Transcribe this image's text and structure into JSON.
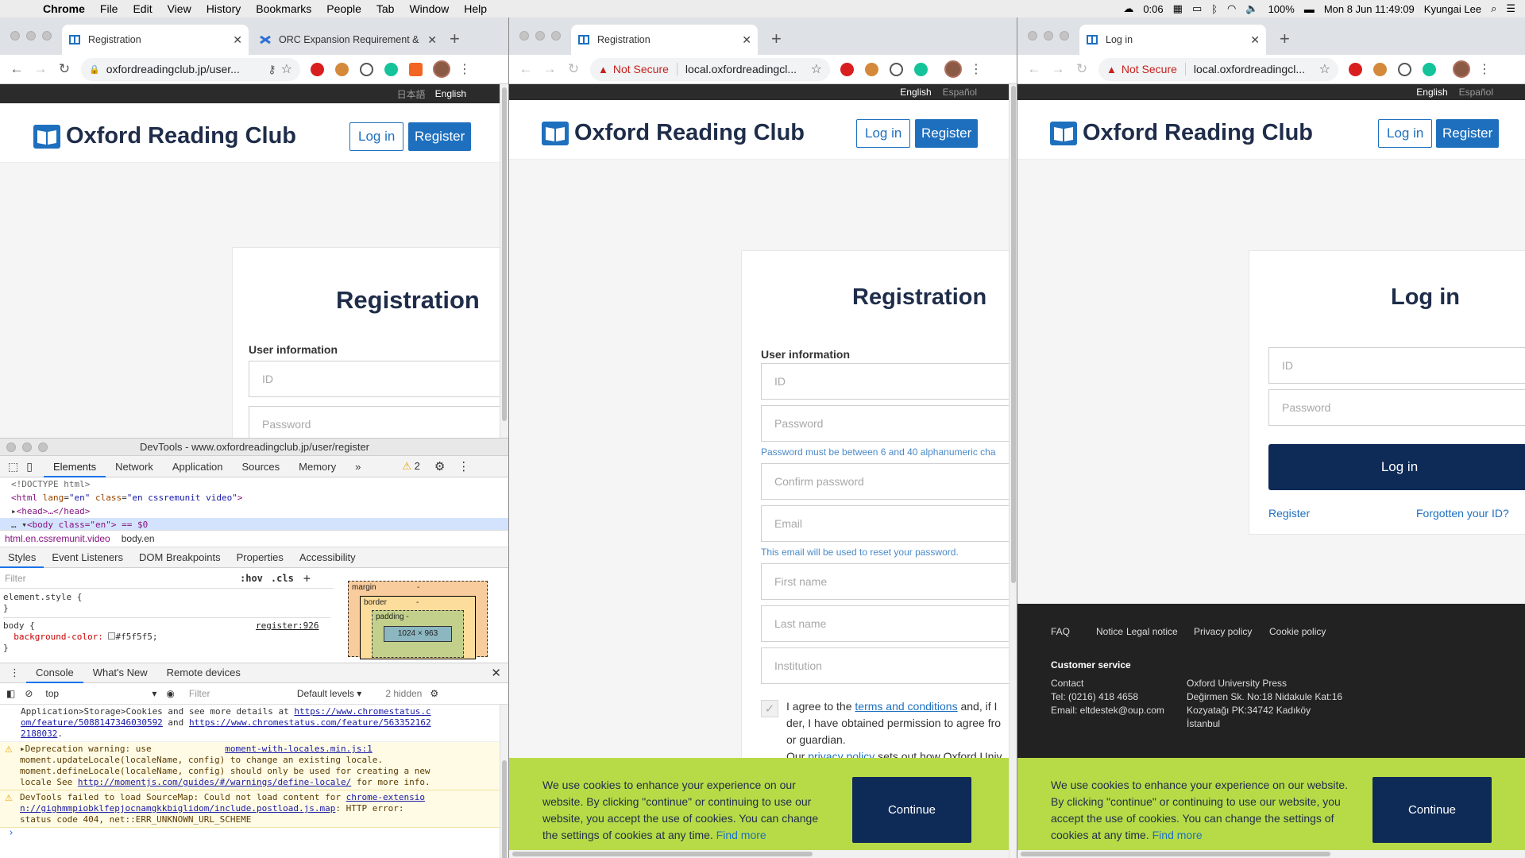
{
  "menubar": {
    "app": "Chrome",
    "items": [
      "File",
      "Edit",
      "View",
      "History",
      "Bookmarks",
      "People",
      "Tab",
      "Window",
      "Help"
    ],
    "clock_small": "0:06",
    "battery": "100%",
    "datetime": "Mon 8 Jun  11:49:09",
    "user": "Kyungai Lee"
  },
  "win1": {
    "tabs": [
      {
        "title": "Registration"
      },
      {
        "title": "ORC Expansion Requirement &"
      }
    ],
    "url": "oxfordreadingclub.jp/user...",
    "langs": [
      "日本語",
      "English"
    ],
    "site": {
      "name": "Oxford Reading Club",
      "login": "Log in",
      "register": "Register"
    },
    "form": {
      "title": "Registration",
      "section": "User information",
      "id_placeholder": "ID",
      "password_placeholder": "Password"
    }
  },
  "devtools": {
    "title": "DevTools - www.oxfordreadingclub.jp/user/register",
    "tabs": [
      "Elements",
      "Network",
      "Application",
      "Sources",
      "Memory",
      "»"
    ],
    "warn_count": "2",
    "dom": {
      "doctype": "<!DOCTYPE html>",
      "html_open": "<html",
      "html_lang_attr": "lang",
      "html_lang_val": "\"en\"",
      "html_class_attr": "class",
      "html_class_val": "\"en cssremunit video\"",
      "head": "<head>…</head>",
      "body": "<body class=\"en\"> == $0"
    },
    "crumbs": [
      "html.en.cssremunit.video",
      "body.en"
    ],
    "subtabs": [
      "Styles",
      "Event Listeners",
      "DOM Breakpoints",
      "Properties",
      "Accessibility"
    ],
    "styles": {
      "filter_placeholder": "Filter",
      "hov": ":hov",
      "cls": ".cls",
      "element_style": "element.style {",
      "close": "}",
      "body_selector": "body {",
      "source": "register:926",
      "prop": "background-color:",
      "value": "#f5f5f5;"
    },
    "boxmodel": {
      "margin": "margin",
      "border": "border",
      "padding": "padding -",
      "content": "1024 × 963",
      "dash": "-"
    },
    "drawer_tabs": [
      "Console",
      "What's New",
      "Remote devices"
    ],
    "console_bar": {
      "context": "top",
      "filter_placeholder": "Filter",
      "levels": "Default levels",
      "hidden": "2 hidden"
    },
    "messages": [
      {
        "text": "Application>Storage>Cookies and see more details at ",
        "link1": "https://www.chromestatus.c",
        "line2_link": "om/feature/5088147346030592",
        "mid": " and ",
        "link2": "https://www.chromestatus.com/feature/563352162",
        "line3_link": "2188032",
        "end": "."
      },
      {
        "line1": "▸Deprecation warning: use ",
        "src": "moment-with-locales.min.js:1",
        "line2": "moment.updateLocale(localeName, config) to change an existing locale.",
        "line3": "moment.defineLocale(localeName, config) should only be used for creating a new",
        "line4a": "locale See ",
        "line4link": "http://momentjs.com/guides/#/warnings/define-locale/",
        "line4b": " for more info."
      },
      {
        "line1": "DevTools failed to load SourceMap: Could not load content for ",
        "link1": "chrome-extensio",
        "link2": "n://gighmmpiobklfepjocnamgkkbiglidom/include.postload.js.map",
        "line2b": ": HTTP error:",
        "line3": "status code 404, net::ERR_UNKNOWN_URL_SCHEME"
      }
    ],
    "prompt": "›"
  },
  "win2": {
    "tab": "Registration",
    "not_secure": "Not Secure",
    "url": "local.oxfordreadingcl...",
    "langs": [
      "English",
      "Español"
    ],
    "site": {
      "name": "Oxford Reading Club",
      "login": "Log in",
      "register": "Register"
    },
    "form": {
      "title": "Registration",
      "section": "User information",
      "id": "ID",
      "password": "Password",
      "password_hint": "Password must be between 6 and 40 alphanumeric cha",
      "confirm": "Confirm password",
      "email": "Email",
      "email_hint": "This email will be used to reset your password.",
      "first": "First name",
      "last": "Last name",
      "institution": "Institution",
      "terms_a": "I agree to the ",
      "terms_link": "terms and conditions",
      "terms_b": " and, if I",
      "terms_l2": "der, I have obtained permission to agree fro",
      "terms_l3": "or guardian.",
      "terms_l4a": "Our ",
      "terms_l4link": "privacy policy",
      "terms_l4b": " sets out how Oxford Univ"
    },
    "cookie": {
      "l1": "We use cookies to enhance your experience on our",
      "l2": "website. By clicking \"continue\" or continuing to use our",
      "l3": "website, you accept the use of cookies. You can change",
      "l4": "the settings of cookies at any time.",
      "find": "Find more",
      "button": "Continue"
    }
  },
  "win3": {
    "tab": "Log in",
    "not_secure": "Not Secure",
    "url": "local.oxfordreadingcl...",
    "langs": [
      "English",
      "Español"
    ],
    "site": {
      "name": "Oxford Reading Club",
      "login": "Log in",
      "register": "Register"
    },
    "form": {
      "title": "Log in",
      "id": "ID",
      "password": "Password",
      "button": "Log in",
      "register": "Register",
      "forgot": "Forgotten your ID?"
    },
    "footer": {
      "links": [
        "FAQ",
        "Notice",
        "Legal notice",
        "Privacy policy",
        "Cookie policy"
      ],
      "cs_title": "Customer service",
      "contact": "Contact",
      "tel": "Tel: (0216) 418 4658",
      "email": "Email: eltdestek@oup.com",
      "addr1": "Oxford University Press",
      "addr2": "Değirmen Sk. No:18 Nidakule Kat:16",
      "addr3": "Kozyatağı PK:34742 Kadıköy",
      "addr4": "İstanbul"
    },
    "cookie": {
      "l1": "We use cookies to enhance your experience on our website.",
      "l2": "By clicking \"continue\" or continuing to use our website, you",
      "l3": "accept the use of cookies. You can change the settings of",
      "l4": "cookies at any time.",
      "find": "Find more",
      "button": "Continue"
    }
  },
  "colors": {
    "brand_blue": "#1e70bf",
    "navy": "#0e2a57",
    "cookie_green": "#b7db47",
    "footer_dark": "#222222",
    "not_secure_red": "#c5221f"
  }
}
